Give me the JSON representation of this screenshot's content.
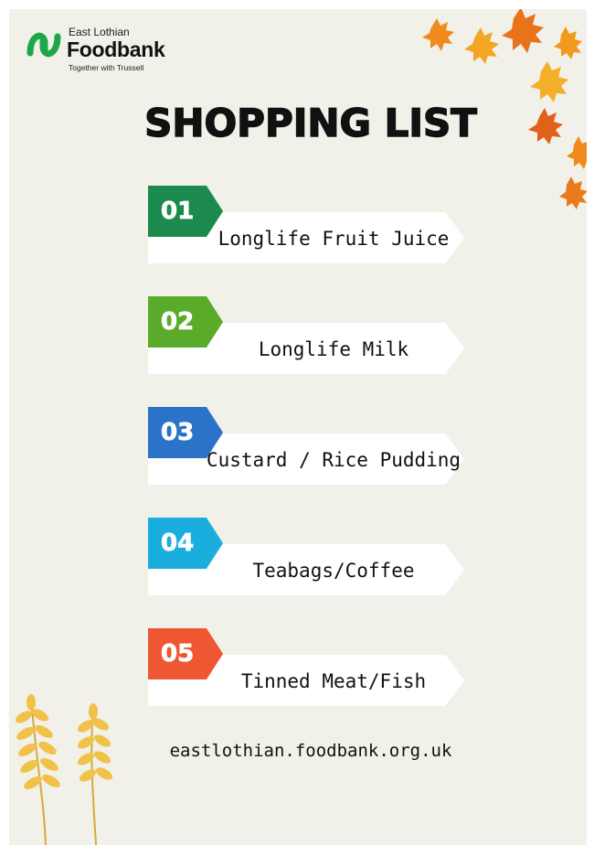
{
  "logo": {
    "subtitle": "East Lothian",
    "name": "Foodbank",
    "tagline": "Together with Trussell"
  },
  "title": "SHOPPING LIST",
  "items": [
    {
      "number": "01",
      "label": "Longlife Fruit Juice",
      "color": "#1b8a4c"
    },
    {
      "number": "02",
      "label": "Longlife Milk",
      "color": "#5aab2a"
    },
    {
      "number": "03",
      "label": "Custard / Rice Pudding",
      "color": "#2a73c9"
    },
    {
      "number": "04",
      "label": "Teabags/Coffee",
      "color": "#1aaedf"
    },
    {
      "number": "05",
      "label": "Tinned Meat/Fish",
      "color": "#ef5632"
    }
  ],
  "website": "eastlothian.foodbank.org.uk",
  "colors": {
    "background": "#f1f1ea",
    "logo_green": "#1ea64a",
    "leaf_orange": "#f08a1c",
    "wheat_yellow": "#f1c24a"
  }
}
